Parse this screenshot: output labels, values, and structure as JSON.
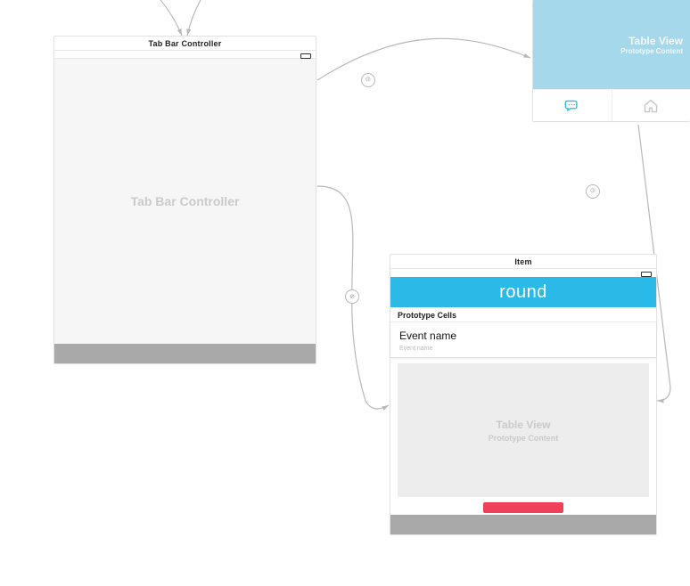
{
  "colors": {
    "brand_blue": "#2bb9e8",
    "brand_blue_light": "#a5d8ea",
    "accent_red": "#f04059",
    "muted_gray": "#a9a9a9"
  },
  "scene_tabbar": {
    "title": "Tab Bar Controller",
    "placeholder": "Tab Bar Controller"
  },
  "scene_item": {
    "title": "Item",
    "nav_title": "round",
    "proto_label": "Prototype Cells",
    "cell_title": "Event name",
    "cell_subtitle": "Event name",
    "table_placeholder_title": "Table View",
    "table_placeholder_sub": "Prototype Content"
  },
  "scene_partial": {
    "placeholder_title": "Table View",
    "placeholder_sub": "Prototype Content"
  },
  "segue_glyphs": {
    "relationship": "⦶",
    "push": "⊘"
  }
}
